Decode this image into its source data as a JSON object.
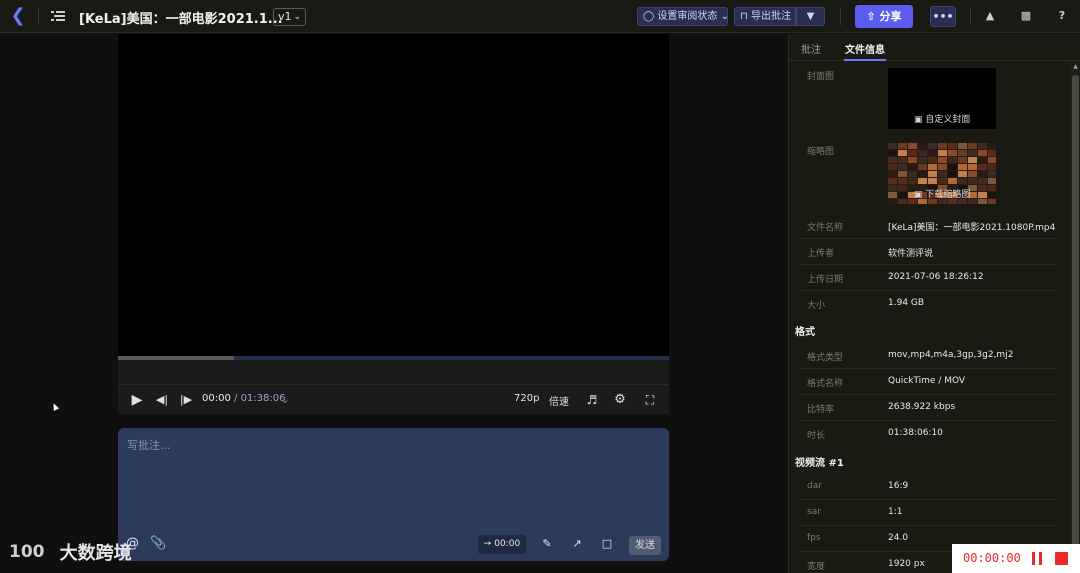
{
  "header": {
    "title": "[KeLa]美国：一部电影2021.1...",
    "version": "v1",
    "review_status": "设置审阅状态",
    "export_comments": "导出批注",
    "share": "分享"
  },
  "player": {
    "progress_fraction": 0.21,
    "current_time": "00:00",
    "duration": "/ 01:38:06",
    "quality": "720p",
    "speed": "倍速"
  },
  "comment": {
    "placeholder": "写批注...",
    "timestamp": "00:00",
    "send": "发送"
  },
  "watermark": {
    "mark": "100",
    "name": "大数跨境"
  },
  "panel": {
    "tabs": [
      "批注",
      "文件信息"
    ],
    "active_tab": 1,
    "cover_label": "封面图",
    "cover_action": "自定义封面",
    "thumb_label": "缩略图",
    "thumb_action": "下载缩略图",
    "file_info": [
      {
        "key": "文件名称",
        "value": "[KeLa]美国：一部电影2021.1080P.mp4"
      },
      {
        "key": "上传者",
        "value": "软件测评说"
      },
      {
        "key": "上传日期",
        "value": "2021-07-06 18:26:12"
      },
      {
        "key": "大小",
        "value": "1.94 GB"
      }
    ],
    "format_section": "格式",
    "format": [
      {
        "key": "格式类型",
        "value": "mov,mp4,m4a,3gp,3g2,mj2"
      },
      {
        "key": "格式名称",
        "value": "QuickTime / MOV"
      },
      {
        "key": "比特率",
        "value": "2638.922 kbps"
      },
      {
        "key": "时长",
        "value": "01:38:06:10"
      }
    ],
    "video_section": "视频流 #1",
    "video": [
      {
        "key": "dar",
        "value": "16:9"
      },
      {
        "key": "sar",
        "value": "1:1"
      },
      {
        "key": "fps",
        "value": "24.0"
      },
      {
        "key": "宽度",
        "value": "1920 px"
      }
    ]
  },
  "recorder": {
    "time": "00:00:00"
  },
  "colors": {
    "accent": "#5b5cf0",
    "recorder_red": "#e82a2a"
  }
}
